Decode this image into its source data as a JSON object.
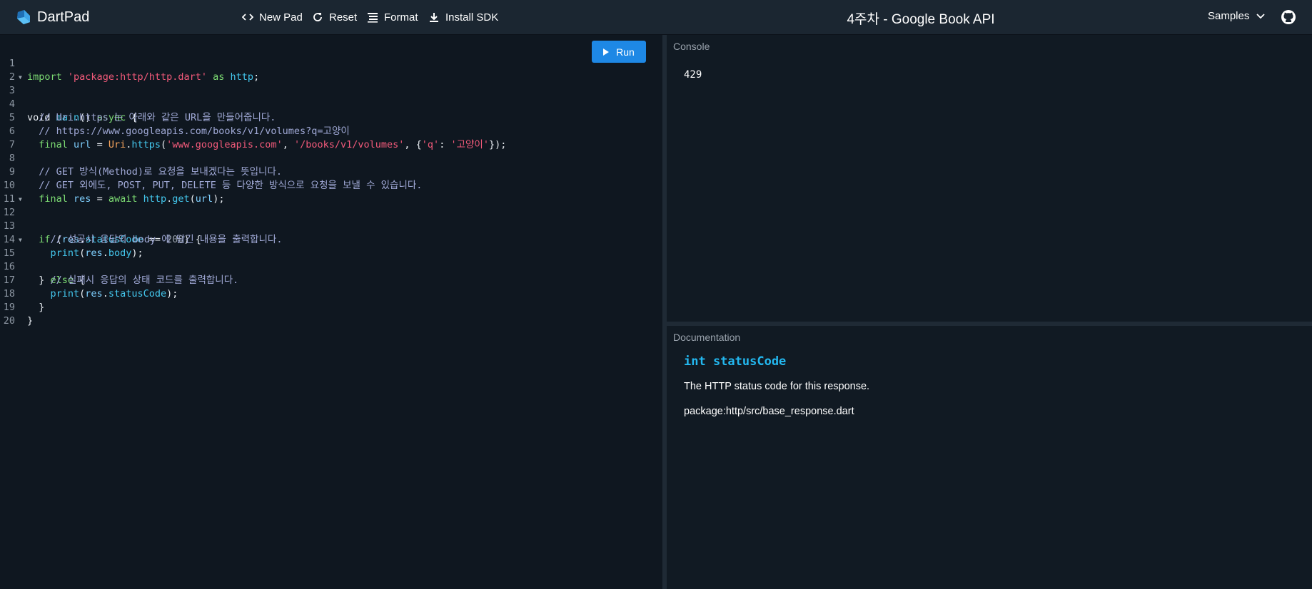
{
  "app": {
    "name": "DartPad",
    "title": "4주차 - Google Book API"
  },
  "toolbar": {
    "new_pad": "New Pad",
    "reset": "Reset",
    "format": "Format",
    "install_sdk": "Install SDK",
    "samples": "Samples"
  },
  "editor": {
    "run_label": "Run",
    "lines": [
      {
        "n": "1",
        "fold": ""
      },
      {
        "n": "2",
        "fold": ""
      },
      {
        "n": "3",
        "fold": "▼"
      },
      {
        "n": "4",
        "fold": ""
      },
      {
        "n": "5",
        "fold": ""
      },
      {
        "n": "6",
        "fold": ""
      },
      {
        "n": "7",
        "fold": ""
      },
      {
        "n": "8",
        "fold": ""
      },
      {
        "n": "9",
        "fold": ""
      },
      {
        "n": "10",
        "fold": ""
      },
      {
        "n": "11",
        "fold": ""
      },
      {
        "n": "12",
        "fold": "▼"
      },
      {
        "n": "13",
        "fold": ""
      },
      {
        "n": "14",
        "fold": ""
      },
      {
        "n": "15",
        "fold": "▼"
      },
      {
        "n": "16",
        "fold": ""
      },
      {
        "n": "17",
        "fold": ""
      },
      {
        "n": "18",
        "fold": ""
      },
      {
        "n": "19",
        "fold": ""
      },
      {
        "n": "20",
        "fold": ""
      }
    ],
    "code": {
      "l1_import": "import",
      "l1_str": "'package:http/http.dart'",
      "l1_as": "as",
      "l1_http": "http",
      "l3_void": "void",
      "l3_main": "main",
      "l3_async": "async",
      "l4": "// Uri.https 는 아래와 같은 URL을 만들어줍니다.",
      "l5": "// https://www.googleapis.com/books/v1/volumes?q=고양이",
      "l6_final": "final",
      "l6_url": "url",
      "l6_uri": "Uri",
      "l6_https": "https",
      "l6_s1": "'www.googleapis.com'",
      "l6_s2": "'/books/v1/volumes'",
      "l6_s3": "'q'",
      "l6_s4": "'고양이'",
      "l8": "// GET 방식(Method)로 요청을 보내겠다는 뜻입니다.",
      "l9": "// GET 외에도, POST, PUT, DELETE 등 다양한 방식으로 요청을 보낼 수 있습니다.",
      "l10_final": "final",
      "l10_res": "res",
      "l10_await": "await",
      "l10_http": "http",
      "l10_get": "get",
      "l10_url": "url",
      "l12_if": "if",
      "l12_res": "res",
      "l12_status": "statusCode",
      "l12_num": "200",
      "l13": "// 성공시 응답의 body 에 담긴 내용을 출력합니다.",
      "l14_print": "print",
      "l14_res": "res",
      "l14_body": "body",
      "l15_else": "else",
      "l16": "// 실패시 응답의 상태 코드를 출력합니다.",
      "l17_print": "print",
      "l17_res": "res",
      "l17_status": "statusCode"
    }
  },
  "console": {
    "label": "Console",
    "output": "429"
  },
  "documentation": {
    "label": "Documentation",
    "signature": "int statusCode",
    "description": "The HTTP status code for this response.",
    "library": "package:http/src/base_response.dart"
  }
}
